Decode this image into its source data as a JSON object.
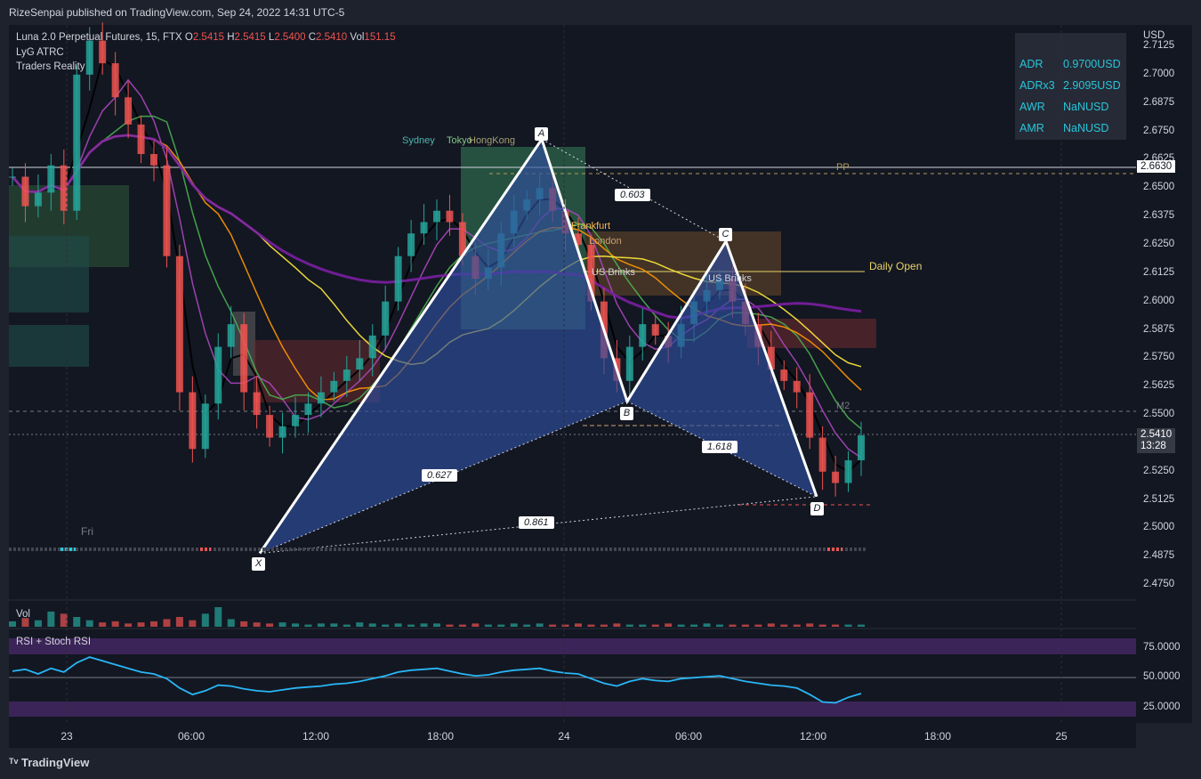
{
  "header": {
    "published": "RizeSenpai published on TradingView.com, Sep 24, 2022 14:31 UTC-5",
    "symbol": "Luna 2.0 Perpetual Futures, 15, FTX",
    "o_label": "O",
    "o_value": "2.5415",
    "h_label": "H",
    "h_value": "2.5415",
    "l_label": "L",
    "l_value": "2.5400",
    "c_label": "C",
    "c_value": "2.5410",
    "vol_label": "Vol",
    "vol_value": "151.15",
    "indicator_1": "LyG ATRC",
    "indicator_2": "Traders Reality"
  },
  "adr_panel": [
    {
      "label": "ADR",
      "value": "0.9700USD"
    },
    {
      "label": "ADRx3",
      "value": "2.9095USD"
    },
    {
      "label": "AWR",
      "value": "NaNUSD"
    },
    {
      "label": "AMR",
      "value": "NaNUSD"
    }
  ],
  "price_axis": {
    "currency": "USD",
    "ticks": [
      "2.7125",
      "2.7000",
      "2.6875",
      "2.6750",
      "2.6625",
      "2.6500",
      "2.6375",
      "2.6250",
      "2.6125",
      "2.6000",
      "2.5875",
      "2.5750",
      "2.5625",
      "2.5500",
      "2.5375",
      "2.5250",
      "2.5125",
      "2.5000",
      "2.4875",
      "2.4750"
    ],
    "tick_values": [
      2.7125,
      2.7,
      2.6875,
      2.675,
      2.6625,
      2.65,
      2.6375,
      2.625,
      2.6125,
      2.6,
      2.5875,
      2.575,
      2.5625,
      2.55,
      2.5375,
      2.525,
      2.5125,
      2.5,
      2.4875,
      2.475
    ],
    "hline_label": "2.6630",
    "current_price": "2.5410",
    "countdown": "13:28"
  },
  "time_axis": [
    "23",
    "06:00",
    "12:00",
    "18:00",
    "24",
    "06:00",
    "12:00",
    "18:00",
    "25"
  ],
  "day_label": "Fri",
  "chart_labels": {
    "sessions": [
      "Sydney",
      "Tokyo",
      "HongKong",
      "Frankfurt",
      "London",
      "US Brinks",
      "US Brinks"
    ],
    "pp": "PP",
    "m2": "M2",
    "daily_open": "Daily Open"
  },
  "volume_pane": {
    "title": "Vol"
  },
  "rsi_pane": {
    "title": "RSI + Stoch RSI",
    "levels": [
      "75.0000",
      "50.0000",
      "25.0000"
    ]
  },
  "chart_data": {
    "type": "line",
    "title": "Luna 2.0 Perpetual Futures, 15, FTX",
    "ylabel": "USD",
    "ylim": [
      2.4688,
      2.7219
    ],
    "pattern": {
      "name": "harmonic XABCD",
      "points": [
        {
          "label": "X",
          "price": 2.489
        },
        {
          "label": "A",
          "price": 2.6715
        },
        {
          "label": "B",
          "price": 2.556
        },
        {
          "label": "C",
          "price": 2.6265
        },
        {
          "label": "D",
          "price": 2.514
        }
      ],
      "ratios": [
        "0.603",
        "0.627",
        "1.618",
        "0.861"
      ]
    },
    "close_series": [
      2.655,
      2.642,
      2.648,
      2.66,
      2.64,
      2.7,
      2.715,
      2.705,
      2.69,
      2.678,
      2.665,
      2.66,
      2.62,
      2.56,
      2.535,
      2.555,
      2.58,
      2.59,
      2.56,
      2.55,
      2.54,
      2.545,
      2.55,
      2.555,
      2.56,
      2.565,
      2.57,
      2.575,
      2.585,
      2.6,
      2.62,
      2.63,
      2.635,
      2.64,
      2.635,
      2.62,
      2.61,
      2.615,
      2.63,
      2.64,
      2.645,
      2.65,
      2.64,
      2.63,
      2.625,
      2.6,
      2.575,
      2.565,
      2.58,
      2.59,
      2.585,
      2.58,
      2.59,
      2.6,
      2.605,
      2.61,
      2.6,
      2.59,
      2.58,
      2.57,
      2.565,
      2.56,
      2.54,
      2.525,
      2.52,
      2.53,
      2.541
    ],
    "rsi_series": [
      63,
      65,
      60,
      66,
      62,
      72,
      78,
      74,
      70,
      66,
      62,
      60,
      55,
      45,
      38,
      42,
      48,
      47,
      44,
      42,
      41,
      43,
      45,
      46,
      47,
      49,
      50,
      52,
      55,
      58,
      62,
      64,
      65,
      66,
      63,
      60,
      58,
      59,
      62,
      64,
      65,
      66,
      63,
      61,
      60,
      55,
      50,
      47,
      52,
      55,
      53,
      52,
      55,
      56,
      57,
      58,
      55,
      52,
      50,
      48,
      47,
      45,
      38,
      30,
      29,
      35,
      39
    ],
    "rsi_levels": [
      75,
      50,
      25
    ],
    "volume_series": [
      5,
      8,
      6,
      14,
      12,
      9,
      6,
      4,
      5,
      3,
      4,
      5,
      7,
      9,
      6,
      12,
      18,
      7,
      5,
      4,
      3,
      4,
      3,
      2,
      3,
      3,
      2,
      4,
      3,
      2,
      3,
      2,
      3,
      3,
      2,
      2,
      3,
      2,
      2,
      3,
      2,
      3,
      2,
      2,
      3,
      2,
      2,
      3,
      2,
      2,
      2,
      3,
      2,
      2,
      3,
      2,
      2,
      2,
      2,
      3,
      2,
      2,
      3,
      2,
      2,
      2,
      2
    ],
    "grid": true
  }
}
